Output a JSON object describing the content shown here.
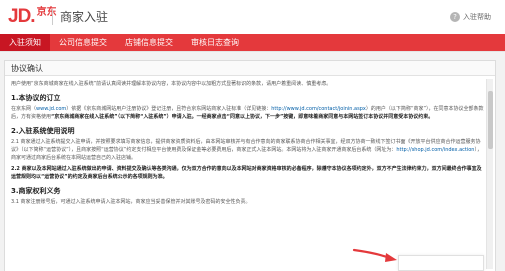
{
  "header": {
    "logo_jd": "JD.",
    "logo_cn": "京东",
    "site_title": "商家入驻",
    "help_icon": "?",
    "help_label": "入驻帮助"
  },
  "nav": {
    "tabs": [
      {
        "label": "入驻须知",
        "active": true
      },
      {
        "label": "公司信息提交",
        "active": false
      },
      {
        "label": "店铺信息提交",
        "active": false
      },
      {
        "label": "审核日志查询",
        "active": false
      }
    ]
  },
  "panel": {
    "title": "协议确认"
  },
  "agreement": {
    "intro": "用户使用“京东商城商家在线入驻系统”前请认真阅读并理解本协议内容，本协议内容中以加粗方式显著标识的条款，请用户着重阅读、慎重考虑。",
    "s1_title": "1.本协议的订立",
    "s1_p1_a": "在京东网（",
    "s1_p1_link1": "www.jd.com",
    "s1_p1_b": "）依据《京东商城网站用户注册协议》登记注册，且符合京东网站商家入驻标准（详见链接：",
    "s1_p1_link2": "http://www.jd.com/contact/joinin.aspx",
    "s1_p1_c": "）的用户（以下简称“商家”），在同意本协议全部条款后，方有资格使用",
    "s1_p1_bold": "“京东商城商家在线入驻系统”（以下简称“入驻系统”）申请入驻。一经商家点击“同意以上协议，下一步”按键，即意味着商家同意与本网站签订本协议并同意受本协议约束。",
    "s2_title": "2.入驻系统使用说明",
    "s2_p1_a": "2.1 商家通过入驻系统提交入驻申请，并按照要求填写商家信息，提供商家资质资料后，由本网站审核并与有合作意向的商家联系协商合作相关事宜，经双方协商一致线下签订书面《开放平台供应商合作运营服务协议》（以下简称“运营协议”），且商家按照“运营协议”约定支付相应平台使用费及保证金等必要费用后，商家正式入驻本网站。本网站将为入驻商家开通商家后台系统（网址为：",
    "s2_p1_link": "http://shop.jd.com/index.action",
    "s2_p1_b": "），商家可通过商家后台系统在本网站运营自己的入驻店铺。",
    "s2_p2": "2.2 商家以及本网站通过入驻系统做出的申请、资料提交及确认等各类沟通，仅为双方合作的意向以及本网站对商家资格审核的必备程序，除遵守本协议各项约定外，双方不产生法律约束力，双方间最终合作事宜及运营规则均以“运营协议”的约定及商家后台系统公示的各项规则为准。",
    "s3_title": "3.商家权利义务",
    "s3_p1": "3.1 商家注册账号后，可通过入驻系统申请入驻本网站，商家应当妥善保管并对其账号及密码的安全性负责。"
  },
  "bottom": {
    "agree_button_label": ""
  }
}
